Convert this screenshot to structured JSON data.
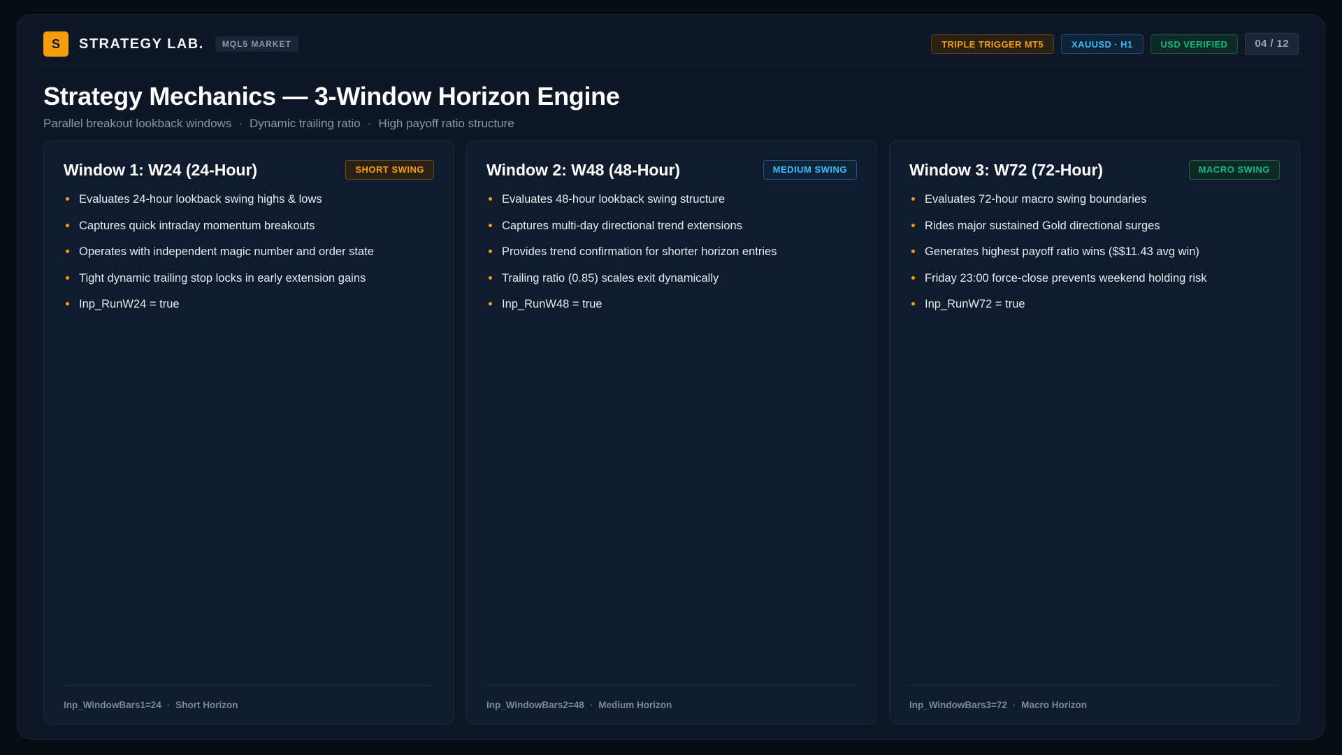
{
  "header": {
    "logo_letter": "S",
    "brand": "STRATEGY LAB.",
    "market_chip": "MQL5 MARKET",
    "badges": [
      "TRIPLE TRIGGER MT5",
      "XAUUSD · H1",
      "USD VERIFIED"
    ],
    "page_indicator": "04 / 12"
  },
  "page": {
    "title": "Strategy Mechanics — 3-Window Horizon Engine",
    "subtitle": [
      "Parallel breakout lookback windows",
      "Dynamic trailing ratio",
      "High payoff ratio structure"
    ],
    "separator": "·"
  },
  "colors": {
    "accent": "#f59e0b",
    "blue": "#38bdf8",
    "green": "#10b981",
    "background": "#0f1727"
  },
  "cards": [
    {
      "title": "Window 1: W24 (24-Hour)",
      "tag": "SHORT SWING",
      "bullets": [
        "Evaluates 24-hour lookback swing highs & lows",
        "Captures quick intraday momentum breakouts",
        "Operates with independent magic number and order state",
        "Tight dynamic trailing stop locks in early extension gains",
        "Inp_RunW24 = true"
      ],
      "footer_param": "Inp_WindowBars1=24",
      "footer_label": "Short Horizon"
    },
    {
      "title": "Window 2: W48 (48-Hour)",
      "tag": "MEDIUM SWING",
      "bullets": [
        "Evaluates 48-hour lookback swing structure",
        "Captures multi-day directional trend extensions",
        "Provides trend confirmation for shorter horizon entries",
        "Trailing ratio (0.85) scales exit dynamically",
        "Inp_RunW48 = true"
      ],
      "footer_param": "Inp_WindowBars2=48",
      "footer_label": "Medium Horizon"
    },
    {
      "title": "Window 3: W72 (72-Hour)",
      "tag": "MACRO SWING",
      "bullets": [
        "Evaluates 72-hour macro swing boundaries",
        "Rides major sustained Gold directional surges",
        "Generates highest payoff ratio wins ($$11.43 avg win)",
        "Friday 23:00 force-close prevents weekend holding risk",
        "Inp_RunW72 = true"
      ],
      "footer_param": "Inp_WindowBars3=72",
      "footer_label": "Macro Horizon"
    }
  ]
}
